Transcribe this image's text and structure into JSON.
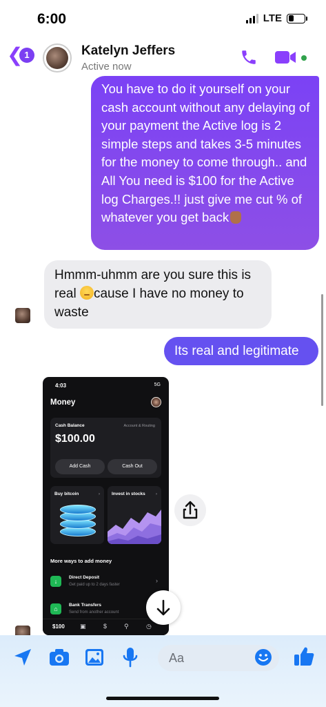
{
  "status_bar": {
    "time": "6:00",
    "network": "LTE"
  },
  "header": {
    "back_badge": "1",
    "contact_name": "Katelyn Jeffers",
    "contact_status": "Active now"
  },
  "messages": {
    "outgoing_1": "You have to do it yourself on your cash account without any delaying of your payment the Active log  is 2 simple steps and takes 3-5 minutes for the money to come through.. and All You need is $100 for the Active log Charges.!! just give me cut % of whatever you get back",
    "incoming_1_part1": "Hmmm-uhmm are you sure this is real ",
    "incoming_1_part2": "cause I have no money to waste",
    "outgoing_2": "Its real and legitimate"
  },
  "shared_screenshot": {
    "time": "4:03",
    "status": "5G",
    "title": "Money",
    "balance_label": "Cash Balance",
    "routing_link": "Account & Routing",
    "balance_amount": "$100.00",
    "add_cash_label": "Add Cash",
    "cash_out_label": "Cash Out",
    "tile_bitcoin_label": "Buy bitcoin",
    "tile_stocks_label": "Invest in stocks",
    "more_ways_label": "More ways to add money",
    "rows": [
      {
        "title": "Direct Deposit",
        "subtitle": "Get paid up to 2 days faster"
      },
      {
        "title": "Bank Transfers",
        "subtitle": "Send from another account"
      }
    ],
    "tabbar_amount": "$100",
    "tabbar_dollar": "$"
  },
  "composer": {
    "placeholder": "Aa"
  },
  "colors": {
    "accent_purple": "#7b42f5",
    "outgoing_blue": "#6551f0",
    "icon_blue": "#1877f2",
    "online_green": "#31a24c"
  }
}
